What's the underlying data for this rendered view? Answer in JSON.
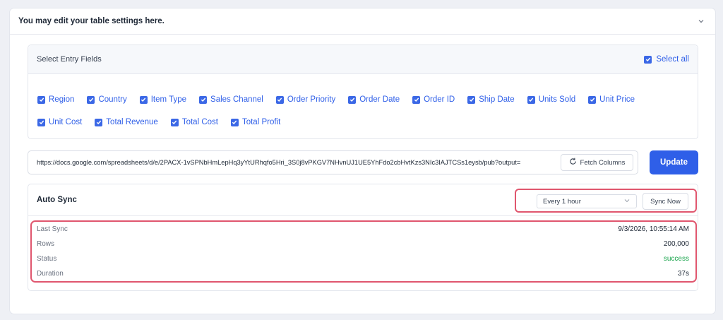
{
  "header": {
    "title": "You may edit your table settings here."
  },
  "fields": {
    "title": "Select Entry Fields",
    "select_all_label": "Select all",
    "row1": [
      "Region",
      "Country",
      "Item Type",
      "Sales Channel",
      "Order Priority",
      "Order Date",
      "Order ID",
      "Ship Date",
      "Units Sold",
      "Unit Price"
    ],
    "row2": [
      "Unit Cost",
      "Total Revenue",
      "Total Cost",
      "Total Profit"
    ]
  },
  "source": {
    "url": "https://docs.google.com/spreadsheets/d/e/2PACX-1vSPNbHmLepHq3yYtURhqfo5Hri_3S0j8vPKGV7NHvnUJ1UE5YhFdo2cbHvtKzs3NIc3IAJTCSs1eysb/pub?output=",
    "fetch_label": "Fetch Columns",
    "update_label": "Update"
  },
  "auto_sync": {
    "title": "Auto Sync",
    "interval": "Every 1 hour",
    "sync_now_label": "Sync Now",
    "info": [
      {
        "label": "Last Sync",
        "value": "9/3/2026, 10:55:14 AM"
      },
      {
        "label": "Rows",
        "value": "200,000"
      },
      {
        "label": "Status",
        "value": "success"
      },
      {
        "label": "Duration",
        "value": "37s"
      }
    ]
  },
  "colors": {
    "accent": "#2f5fe8",
    "highlight": "#e0566e",
    "success": "#16a34a"
  },
  "icons": {
    "collapse": "chevron-down-icon",
    "check": "check-icon",
    "refresh": "refresh-icon",
    "select": "chevron-down-icon"
  }
}
